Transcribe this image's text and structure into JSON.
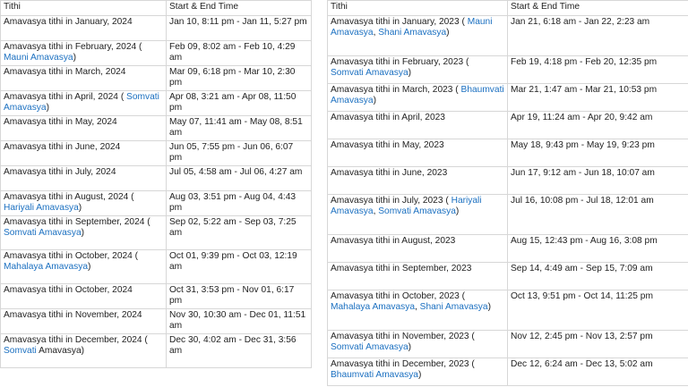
{
  "table2024": {
    "header": {
      "tithi": "Tithi",
      "time": "Start & End Time"
    },
    "rows": [
      {
        "tithi": "Amavasya tithi in January, 2024",
        "links": [],
        "time": "Jan 10, 8:11 pm - Jan 11, 5:27 pm"
      },
      {
        "tithi": "Amavasya tithi in February, 2024",
        "links": [
          "Mauni Amavasya"
        ],
        "time": "Feb 09, 8:02 am - Feb 10, 4:29 am"
      },
      {
        "tithi": "Amavasya tithi in March, 2024",
        "links": [],
        "time": "Mar 09, 6:18 pm - Mar 10, 2:30 pm"
      },
      {
        "tithi": "Amavasya tithi in April, 2024",
        "links": [
          "Somvati Amavasya"
        ],
        "time": "Apr 08, 3:21 am - Apr 08, 11:50 pm"
      },
      {
        "tithi": "Amavasya tithi in May, 2024",
        "links": [],
        "time": "May 07, 11:41 am - May 08, 8:51 am"
      },
      {
        "tithi": "Amavasya tithi in June, 2024",
        "links": [],
        "time": "Jun 05, 7:55 pm - Jun 06, 6:07 pm"
      },
      {
        "tithi": "Amavasya tithi in July, 2024",
        "links": [],
        "time": "Jul 05, 4:58 am - Jul 06, 4:27 am"
      },
      {
        "tithi": "Amavasya tithi in August, 2024",
        "links": [
          "Hariyali Amavasya"
        ],
        "time": "Aug 03, 3:51 pm - Aug 04, 4:43 pm"
      },
      {
        "tithi": "Amavasya tithi in September, 2024",
        "links": [
          "Somvati Amavasya"
        ],
        "time": "Sep 02, 5:22 am - Sep 03, 7:25 am"
      },
      {
        "tithi": "Amavasya tithi in October, 2024",
        "links": [
          "Mahalaya Amavasya"
        ],
        "time": "Oct 01, 9:39 pm - Oct 03, 12:19 am"
      },
      {
        "tithi": "Amavasya tithi in October, 2024",
        "links": [],
        "time": "Oct 31, 3:53 pm - Nov 01, 6:17 pm"
      },
      {
        "tithi": "Amavasya tithi in November, 2024",
        "links": [],
        "time": "Nov 30, 10:30 am - Dec 01, 11:51 am"
      },
      {
        "tithi": "Amavasya tithi in December, 2024",
        "links": [
          "Somvati"
        ],
        "suffix": " Amavasya",
        "time": "Dec 30, 4:02 am - Dec 31, 3:56 am"
      }
    ]
  },
  "table2023": {
    "header": {
      "tithi": "Tithi",
      "time": "Start & End Time"
    },
    "rows": [
      {
        "tithi": "Amavasya tithi in January, 2023",
        "links": [
          "Mauni Amavasya",
          "Shani Amavasya"
        ],
        "time": "Jan 21, 6:18 am - Jan 22, 2:23 am"
      },
      {
        "tithi": "Amavasya tithi in February, 2023",
        "links": [
          "Somvati Amavasya"
        ],
        "time": "Feb 19, 4:18 pm - Feb 20, 12:35 pm"
      },
      {
        "tithi": "Amavasya tithi in March, 2023",
        "links": [
          "Bhaumvati Amavasya"
        ],
        "time": "Mar 21, 1:47 am - Mar 21, 10:53 pm"
      },
      {
        "tithi": "Amavasya tithi in April, 2023",
        "links": [],
        "time": "Apr 19, 11:24 am - Apr 20, 9:42 am"
      },
      {
        "tithi": "Amavasya tithi in May, 2023",
        "links": [],
        "time": "May 18, 9:43 pm - May 19, 9:23 pm"
      },
      {
        "tithi": "Amavasya tithi in June, 2023",
        "links": [],
        "time": "Jun 17, 9:12 am - Jun 18, 10:07 am"
      },
      {
        "tithi": "Amavasya tithi in July, 2023",
        "links": [
          "Hariyali Amavasya",
          "Somvati Amavasya"
        ],
        "time": "Jul 16, 10:08 pm - Jul 18, 12:01 am"
      },
      {
        "tithi": "Amavasya tithi in August, 2023",
        "links": [],
        "time": "Aug 15, 12:43 pm - Aug 16, 3:08 pm"
      },
      {
        "tithi": "Amavasya tithi in September, 2023",
        "links": [],
        "time": "Sep 14, 4:49 am - Sep 15, 7:09 am"
      },
      {
        "tithi": "Amavasya tithi in October, 2023",
        "links": [
          "Mahalaya Amavasya",
          "Shani Amavasya"
        ],
        "time": "Oct 13, 9:51 pm - Oct 14, 11:25 pm"
      },
      {
        "tithi": "Amavasya tithi in November, 2023",
        "links": [
          "Somvati Amavasya"
        ],
        "time": "Nov 12, 2:45 pm - Nov 13, 2:57 pm"
      },
      {
        "tithi": "Amavasya tithi in December, 2023",
        "links": [
          "Bhaumvati Amavasya"
        ],
        "time": "Dec 12, 6:24 am - Dec 13, 5:02 am"
      }
    ]
  },
  "colors": {
    "link": "#1a6fc0",
    "text": "#222222",
    "border": "#d7d7d7"
  }
}
